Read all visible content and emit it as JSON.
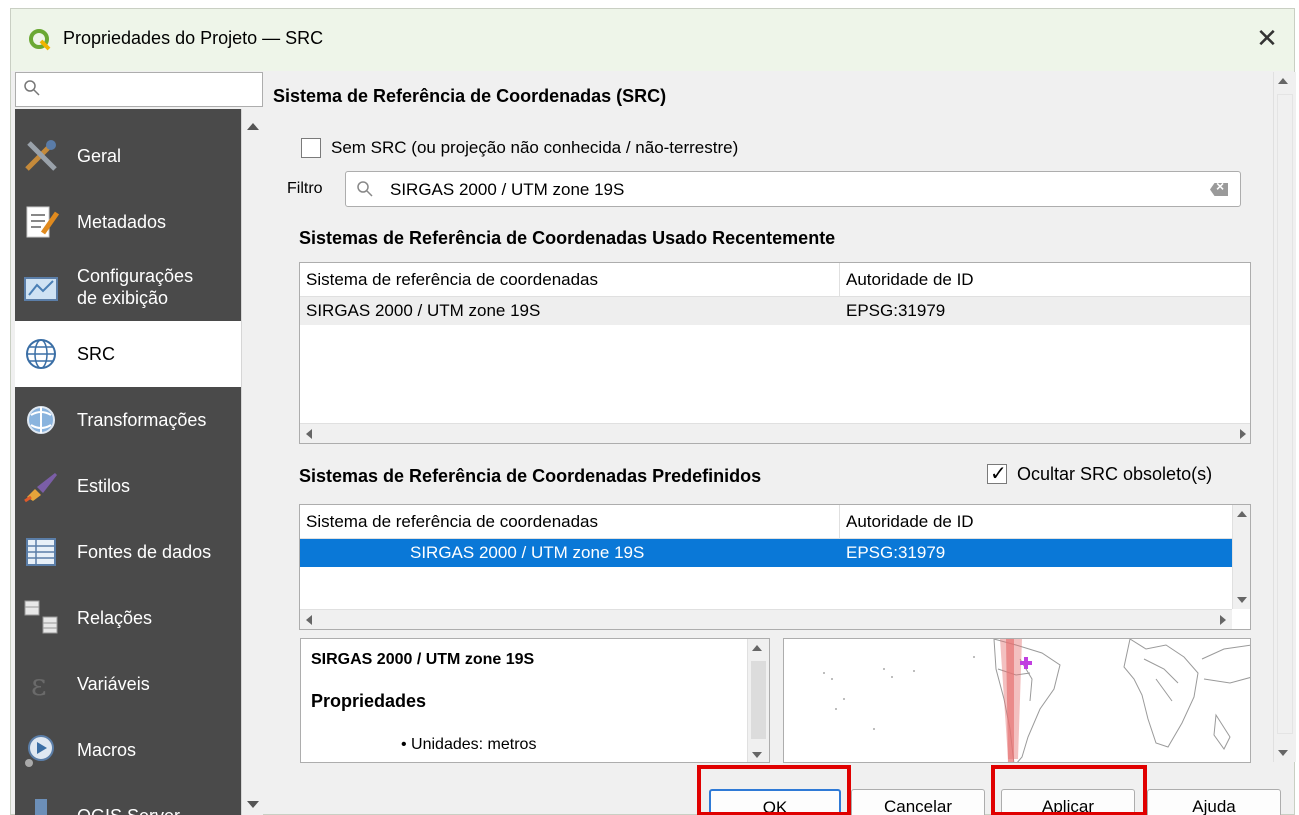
{
  "window": {
    "title": "Propriedades do Projeto — SRC",
    "close_icon": "close-icon",
    "accent_color": "#eef5e9"
  },
  "sidebar": {
    "search_placeholder": "",
    "items": [
      {
        "label": "Geral",
        "icon": "tools-icon"
      },
      {
        "label": "Metadados",
        "icon": "document-pencil-icon"
      },
      {
        "label": "Configurações\nde exibição",
        "label_1": "Configurações",
        "label_2": "de exibição",
        "icon": "view-settings-icon"
      },
      {
        "label": "SRC",
        "icon": "globe-grid-icon"
      },
      {
        "label": "Transformações",
        "icon": "globe-transform-icon"
      },
      {
        "label": "Estilos",
        "icon": "brush-icon"
      },
      {
        "label": "Fontes de dados",
        "icon": "table-icon"
      },
      {
        "label": "Relações",
        "icon": "relations-icon"
      },
      {
        "label": "Variáveis",
        "icon": "epsilon-icon"
      },
      {
        "label": "Macros",
        "icon": "macros-icon"
      },
      {
        "label": "QGIS Server",
        "icon": "server-icon"
      }
    ],
    "active_index": 3,
    "colors": {
      "background": "#4a4a4a",
      "active": "#ffffff"
    }
  },
  "main": {
    "heading": "Sistema de Referência de Coordenadas (SRC)",
    "no_crs_checkbox": {
      "label": "Sem SRC (ou projeção não conhecida / não-terrestre)",
      "checked": false
    },
    "filter": {
      "label": "Filtro",
      "value": "SIRGAS 2000 / UTM zone 19S"
    },
    "recent": {
      "title": "Sistemas de Referência de Coordenadas Usado Recentemente",
      "columns": [
        "Sistema de referência de coordenadas",
        "Autoridade de ID"
      ],
      "rows": [
        {
          "name": "SIRGAS 2000 / UTM zone 19S",
          "auth": "EPSG:31979"
        }
      ]
    },
    "predefined": {
      "title": "Sistemas de Referência de Coordenadas Predefinidos",
      "hide_deprecated": {
        "label": "Ocultar SRC obsoleto(s)",
        "checked": true
      },
      "columns": [
        "Sistema de referência de coordenadas",
        "Autoridade de ID"
      ],
      "rows": [
        {
          "name": "SIRGAS 2000 / UTM zone 19S",
          "auth": "EPSG:31979",
          "selected": true
        }
      ],
      "selection_color": "#0a78d7"
    },
    "details": {
      "crs_name": "SIRGAS 2000 / UTM zone 19S",
      "properties_heading": "Propriedades",
      "units": "Unidades: metros"
    }
  },
  "buttons": {
    "ok": "OK",
    "cancel": "Cancelar",
    "apply": "Aplicar",
    "help": "Ajuda",
    "highlight_color": "#e00000"
  }
}
